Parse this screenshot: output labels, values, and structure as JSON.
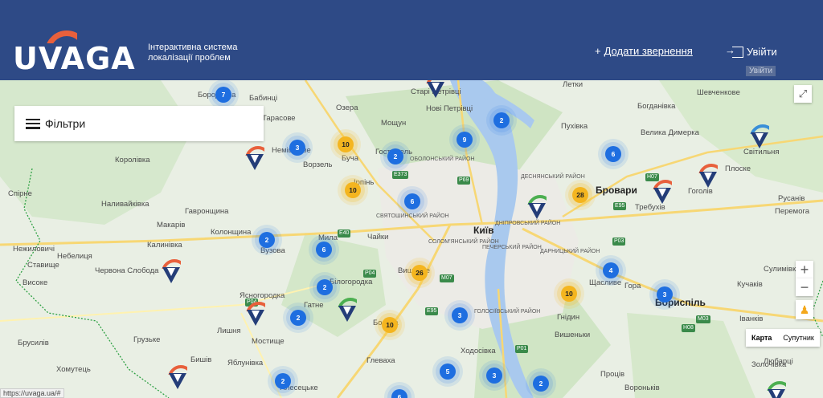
{
  "header": {
    "logo": "UVAGA",
    "tagline": "Інтерактивна система локалізації проблем",
    "add_prefix": "+",
    "add_label": "Додати звернення",
    "login_label": "Увійти",
    "tooltip": "Увійти"
  },
  "filters": {
    "label": "Фільтри"
  },
  "map_controls": {
    "zoom_in": "+",
    "zoom_out": "−",
    "type_map": "Карта",
    "type_satellite": "Супутник"
  },
  "status_url": "https://uvaga.ua/#",
  "places": [
    "Старі Петрівці",
    "Нові Петрівці",
    "Бородянка",
    "Бабинці",
    "Озера",
    "Мощун",
    "Тарасове",
    "Немішаєве",
    "Ворзель",
    "Буча",
    "Гостомель",
    "Ірпінь",
    "Королівка",
    "Спірне",
    "Наливайківка",
    "Гавронщина",
    "Макарів",
    "Колонщина",
    "Калинівка",
    "Вузова",
    "Мила",
    "Чайки",
    "Нежиловичі",
    "Небелиця",
    "Червона Слобода",
    "Ставище",
    "Високе",
    "Ясногородка",
    "Білогородка",
    "Вишневе",
    "Боярка",
    "Гатне",
    "Лишня",
    "Мостище",
    "Грузьке",
    "Бишів",
    "Яблунівка",
    "Брусилів",
    "Хомутець",
    "Плесецьке",
    "Глеваха",
    "Ходосівка",
    "Проців",
    "Вороньків",
    "Гнідин",
    "Вишеньки",
    "Щасливе",
    "Гора",
    "Бориспіль",
    "Кучаків",
    "Сулимівка",
    "Іванків",
    "Золочівка",
    "Бровари",
    "Требухів",
    "Гоголів",
    "Світильня",
    "Плоске",
    "Русанів",
    "Перемога",
    "Шевченкове",
    "Богданівка",
    "Пухівка",
    "Велика Димерка",
    "Летки",
    "Київ",
    "Любарці"
  ],
  "districts": [
    "ОБОЛОНСЬКИЙ РАЙОН",
    "СВЯТОШИНСЬКИЙ РАЙОН",
    "ДЕСНЯНСЬКИЙ РАЙОН",
    "ДНІПРОВСЬКИЙ РАЙОН",
    "СОЛОМ'ЯНСЬКИЙ РАЙОН",
    "ПЕЧЕРСЬКИЙ РАЙОН",
    "ДАРНИЦЬКИЙ РАЙОН",
    "ГОЛОСІЇВСЬКИЙ РАЙОН"
  ],
  "roads": [
    "E373",
    "P69",
    "E40",
    "P04",
    "M07",
    "E95",
    "M03",
    "P03",
    "H07",
    "E95",
    "H08",
    "P01",
    "P04"
  ],
  "clusters": [
    {
      "count": "7",
      "color": "blue"
    },
    {
      "count": "3",
      "color": "blue"
    },
    {
      "count": "10",
      "color": "yellow"
    },
    {
      "count": "2",
      "color": "blue"
    },
    {
      "count": "9",
      "color": "blue"
    },
    {
      "count": "2",
      "color": "blue"
    },
    {
      "count": "6",
      "color": "blue"
    },
    {
      "count": "10",
      "color": "yellow"
    },
    {
      "count": "6",
      "color": "blue"
    },
    {
      "count": "28",
      "color": "yellow"
    },
    {
      "count": "2",
      "color": "blue"
    },
    {
      "count": "6",
      "color": "blue"
    },
    {
      "count": "26",
      "color": "yellow"
    },
    {
      "count": "2",
      "color": "blue"
    },
    {
      "count": "4",
      "color": "blue"
    },
    {
      "count": "10",
      "color": "yellow"
    },
    {
      "count": "3",
      "color": "blue"
    },
    {
      "count": "2",
      "color": "blue"
    },
    {
      "count": "3",
      "color": "blue"
    },
    {
      "count": "10",
      "color": "yellow"
    },
    {
      "count": "2",
      "color": "blue"
    },
    {
      "count": "5",
      "color": "blue"
    },
    {
      "count": "3",
      "color": "blue"
    },
    {
      "count": "2",
      "color": "blue"
    },
    {
      "count": "6",
      "color": "blue"
    }
  ],
  "colors": {
    "header_bg": "#2e4a86",
    "accent_orange": "#e8603c",
    "marker_blue": "#1e6ee0",
    "marker_yellow": "#f4b51f"
  }
}
